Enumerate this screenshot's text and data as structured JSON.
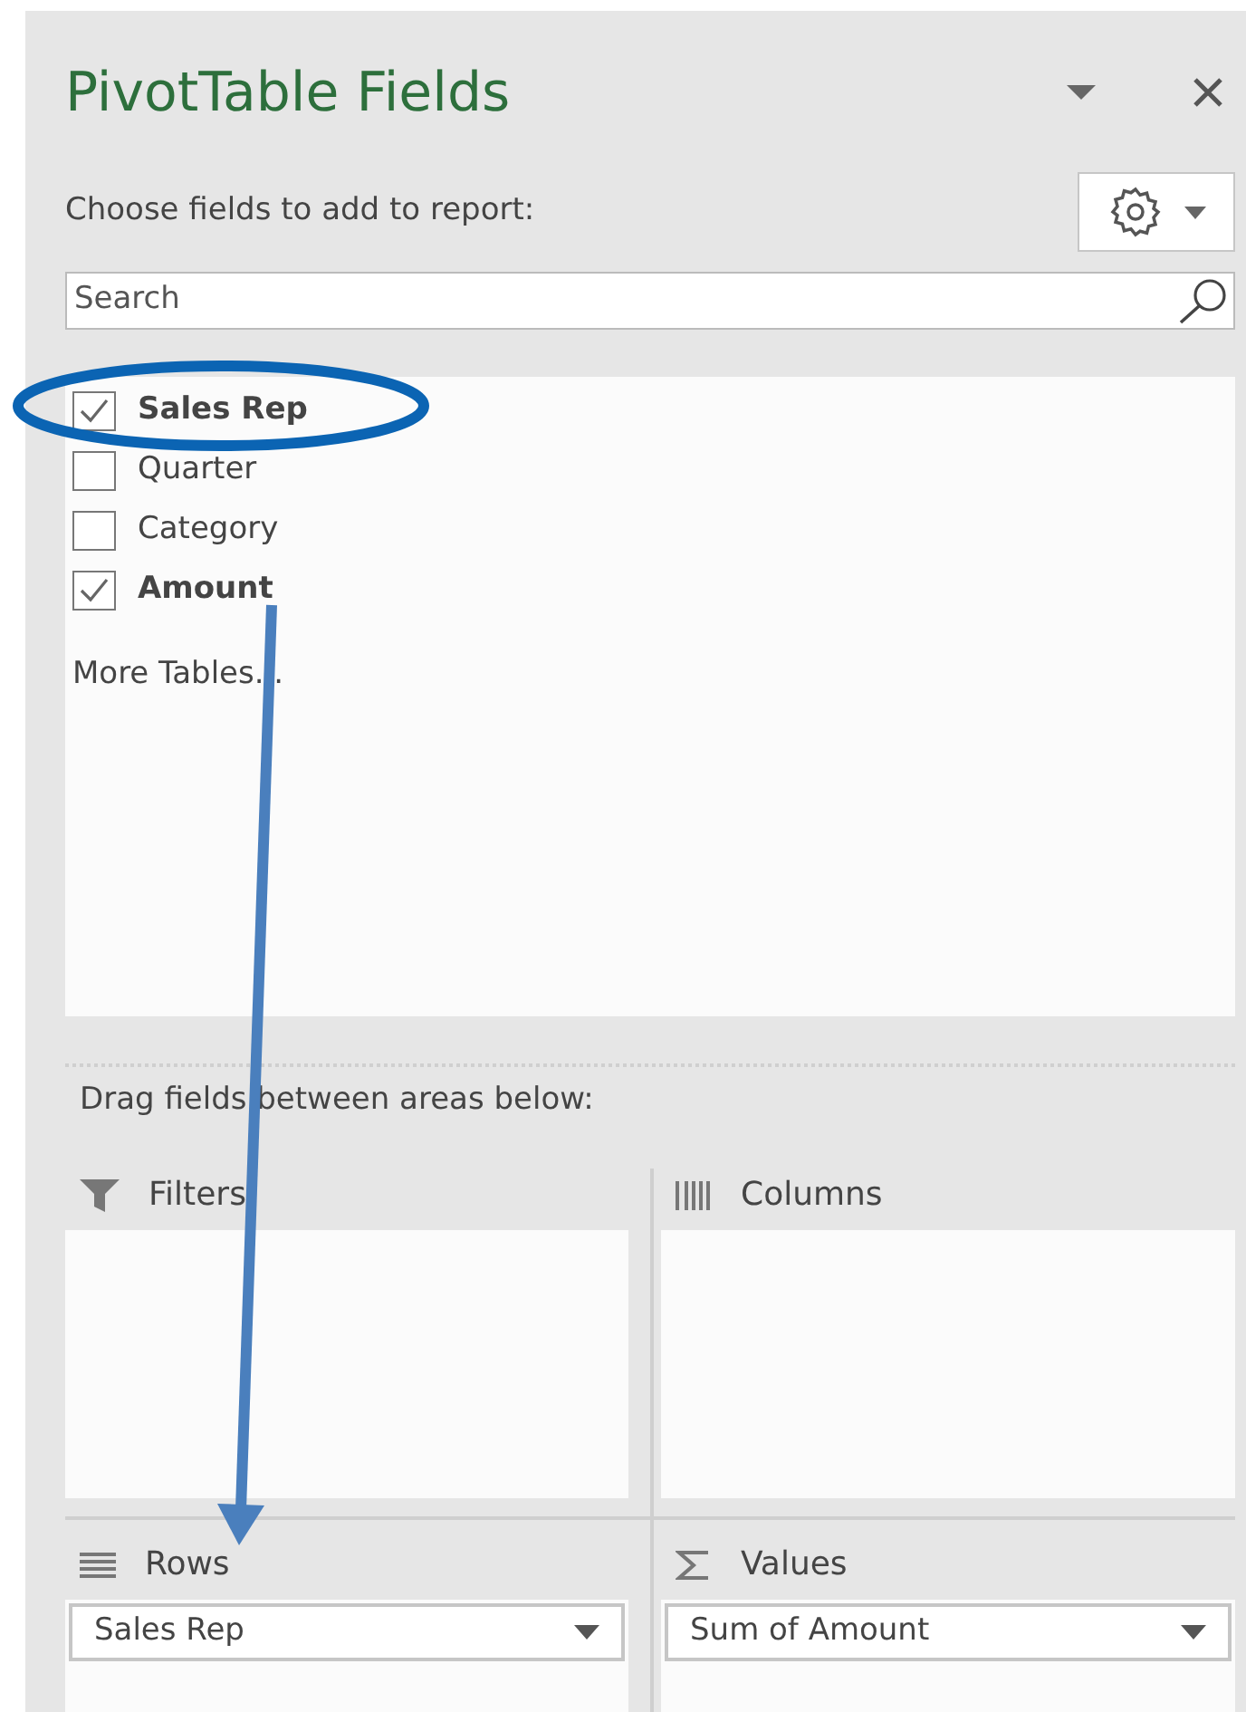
{
  "panel": {
    "title": "PivotTable Fields",
    "prompt": "Choose fields to add to report:"
  },
  "search": {
    "placeholder": "Search"
  },
  "fields": [
    {
      "label": "Sales Rep",
      "checked": true
    },
    {
      "label": "Quarter",
      "checked": false
    },
    {
      "label": "Category",
      "checked": false
    },
    {
      "label": "Amount",
      "checked": true
    }
  ],
  "more_tables": "More Tables...",
  "areas_prompt": "Drag fields between areas below:",
  "areas": [
    {
      "kind": "filters",
      "label": "Filters"
    },
    {
      "kind": "columns",
      "label": "Columns"
    },
    {
      "kind": "rows",
      "label": "Rows",
      "items": [
        "Sales Rep"
      ]
    },
    {
      "kind": "values",
      "label": "Values",
      "items": [
        "Sum of Amount"
      ]
    }
  ]
}
